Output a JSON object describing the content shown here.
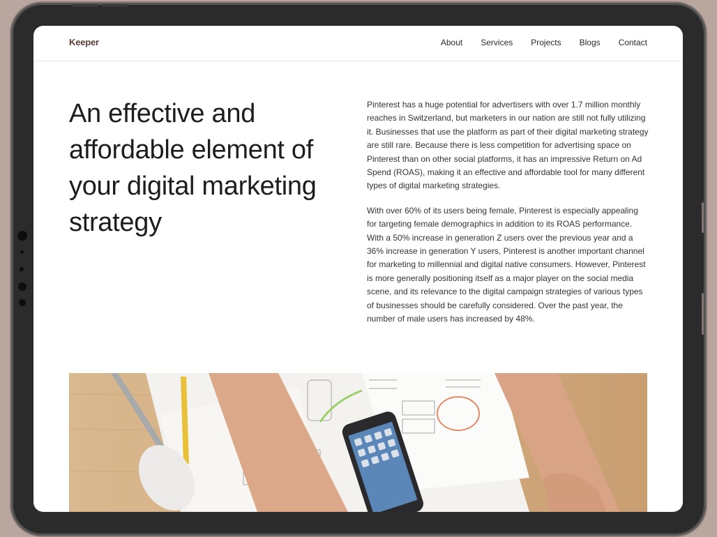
{
  "nav": {
    "brand": "Keeper",
    "links": [
      {
        "label": "About"
      },
      {
        "label": "Services"
      },
      {
        "label": "Projects"
      },
      {
        "label": "Blogs"
      },
      {
        "label": "Contact"
      }
    ]
  },
  "hero": {
    "headline": "An effective and affordable element of your digital marketing strategy",
    "paragraphs": [
      "Pinterest has a huge potential for advertisers with over 1.7 million monthly reaches in Switzerland, but marketers in our nation are still not fully utilizing it. Businesses that use the platform as part of their digital marketing strategy are still rare. Because there is less competition for advertising space on Pinterest than on other social platforms, it has an impressive Return on Ad Spend (ROAS), making it an effective and affordable tool for many different types of digital marketing strategies.",
      "With over 60% of its users being female, Pinterest is especially appealing for targeting female demographics in addition to its ROAS performance. With a 50% increase in generation Z users over the previous year and a 36% increase in generation Y users, Pinterest is another important channel for marketing to millennial and digital native consumers. However, Pinterest is more generally positioning itself as a major player on the social media scene, and its relevance to the digital campaign strategies of various types of businesses should be carefully considered. Over the past year, the number of male users has increased by 48%."
    ]
  },
  "colors": {
    "backdrop": "#b9a69f",
    "bezel": "#2b2b2b",
    "brand": "#5a3d36",
    "text": "#1d1d1d",
    "desk_wood": "#d8b58a"
  }
}
